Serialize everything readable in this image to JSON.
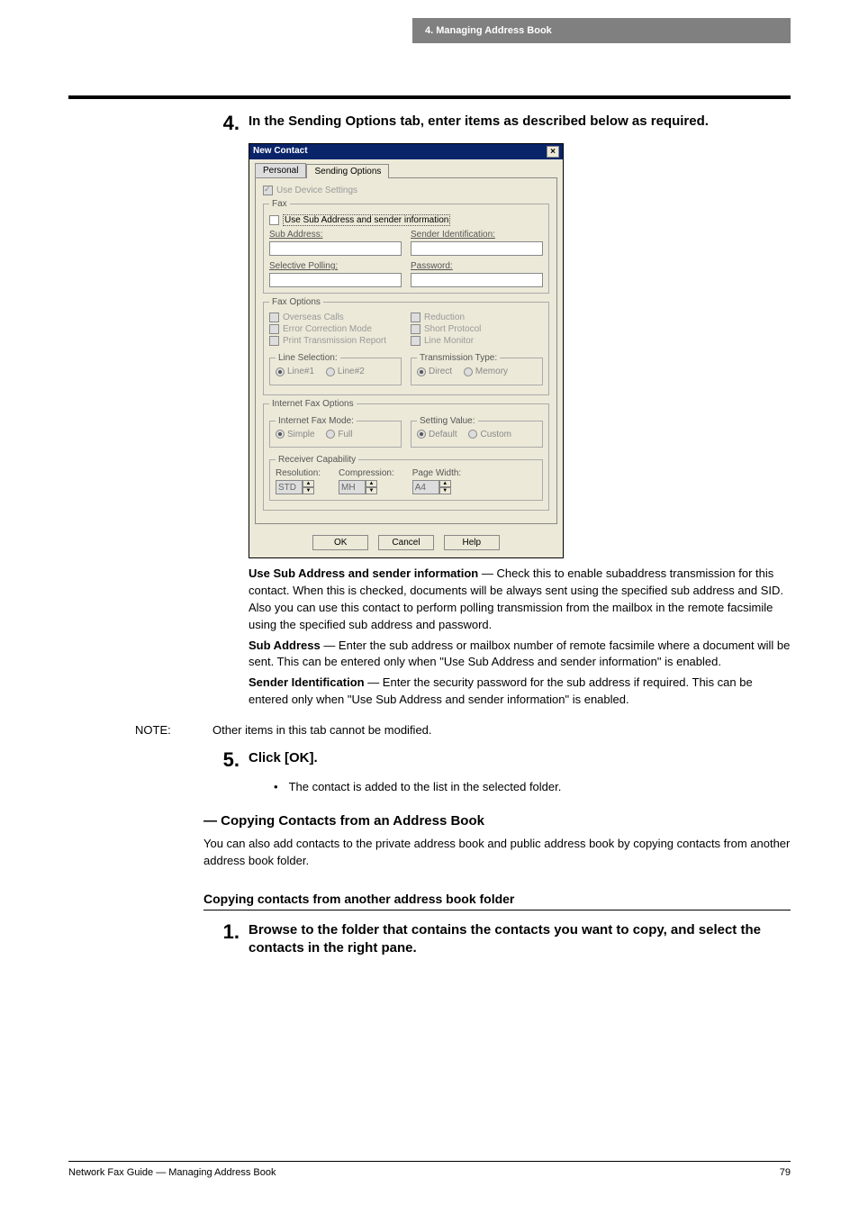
{
  "header": {
    "chapter": "4.  Managing Address Book"
  },
  "step4": {
    "num": "4.",
    "title": "In the Sending Options tab, enter items as described below as required."
  },
  "dialog": {
    "title": "New Contact",
    "close": "×",
    "tabs": {
      "personal": "Personal",
      "sending": "Sending Options"
    },
    "useDevice": "Use Device Settings",
    "faxLegend": "Fax",
    "useSubChk": "Use Sub Address and sender information",
    "subAddrLbl": "Sub Address:",
    "senderIdLbl": "Sender Identification:",
    "selPollLbl": "Selective Polling:",
    "passLbl": "Password:",
    "faxOptLegend": "Fax Options",
    "overseas": "Overseas Calls",
    "ecm": "Error Correction Mode",
    "printTrans": "Print Transmission Report",
    "reduction": "Reduction",
    "shortProto": "Short Protocol",
    "lineMon": "Line Monitor",
    "lineSelLegend": "Line Selection:",
    "line1": "Line#1",
    "line2": "Line#2",
    "txTypeLegend": "Transmission Type:",
    "direct": "Direct",
    "memory": "Memory",
    "ifaxLegend": "Internet Fax Options",
    "ifaxModeLegend": "Internet Fax Mode:",
    "simple": "Simple",
    "full": "Full",
    "setValLegend": "Setting Value:",
    "default": "Default",
    "custom": "Custom",
    "recvCapLegend": "Receiver Capability",
    "resLbl": "Resolution:",
    "resVal": "STD",
    "compLbl": "Compression:",
    "compVal": "MH",
    "pwLbl": "Page Width:",
    "pwVal": "A4",
    "ok": "OK",
    "cancel": "Cancel",
    "help": "Help"
  },
  "defs": {
    "useSub_b": "Use Sub Address and sender information",
    "useSub_t": " — Check this to enable subaddress transmission for this contact.  When this is checked, documents will be always sent using the specified sub address and SID.  Also you can use this contact to perform polling transmission from the mailbox in the remote facsimile using the specified sub address and password.",
    "subAddr_b": "Sub Address",
    "subAddr_t": " — Enter the sub address or mailbox number of remote facsimile where a document will be sent.  This can be entered only when \"Use Sub Address and sender information\" is enabled.",
    "senderId_b": "Sender Identification",
    "senderId_t": " — Enter the security password for the sub address if required.  This can be entered only when \"Use Sub Address and sender information\" is enabled."
  },
  "note": {
    "label": "NOTE:",
    "text": "Other items in this tab cannot be modified."
  },
  "step5": {
    "num": "5.",
    "title": "Click [OK].",
    "bulletMark": "•",
    "bullet": "The contact is added to the list in the selected folder."
  },
  "h2": "— Copying Contacts from an Address Book",
  "h2para": "You can also add contacts to the private address book and public address book by copying contacts from another address book folder.",
  "h3": "Copying contacts from another address book folder",
  "step1": {
    "num": "1.",
    "title": "Browse to the folder that contains the contacts you want to copy, and select the contacts in the right pane."
  },
  "footer": {
    "left": "Network Fax Guide — Managing Address Book",
    "right": "79"
  }
}
